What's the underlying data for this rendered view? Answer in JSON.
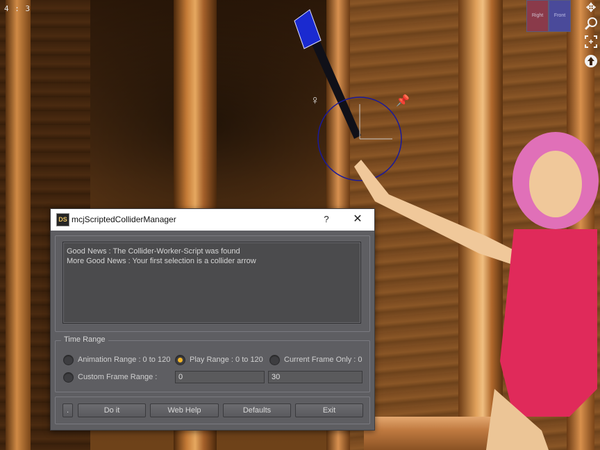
{
  "viewport": {
    "aspect_label": "4 : 3",
    "camera_cube": {
      "right_label": "Right",
      "front_label": "Front"
    },
    "tools": [
      {
        "icon": "move-arrows-icon",
        "glyph": "✥"
      },
      {
        "icon": "zoom-icon",
        "glyph": "🔍"
      },
      {
        "icon": "frame-icon",
        "glyph": "⛶"
      },
      {
        "icon": "orbit-icon",
        "glyph": "⬆"
      }
    ]
  },
  "dialog": {
    "title": "mcjScriptedColliderManager",
    "help_label": "?",
    "close_label": "✕",
    "logo_label": "DS",
    "log_lines": [
      "Good News : The Collider-Worker-Script was found",
      "More Good News : Your first selection is a collider arrow"
    ],
    "time_range": {
      "title": "Time Range",
      "options": [
        {
          "label": "Animation Range : 0 to 120",
          "checked": false
        },
        {
          "label": "Play Range : 0 to 120",
          "checked": true
        },
        {
          "label": "Current Frame Only : 0",
          "checked": false
        },
        {
          "label": "Custom Frame Range :",
          "checked": false
        }
      ],
      "custom_start": "0",
      "custom_end": "30"
    },
    "buttons": {
      "dot": ".",
      "do_it": "Do it",
      "web_help": "Web Help",
      "defaults": "Defaults",
      "exit": "Exit"
    }
  },
  "colors": {
    "accent_radio": "#f0b428",
    "dialog_bg": "#5e5e62",
    "manipulator_ring": "#1a1a9a"
  }
}
